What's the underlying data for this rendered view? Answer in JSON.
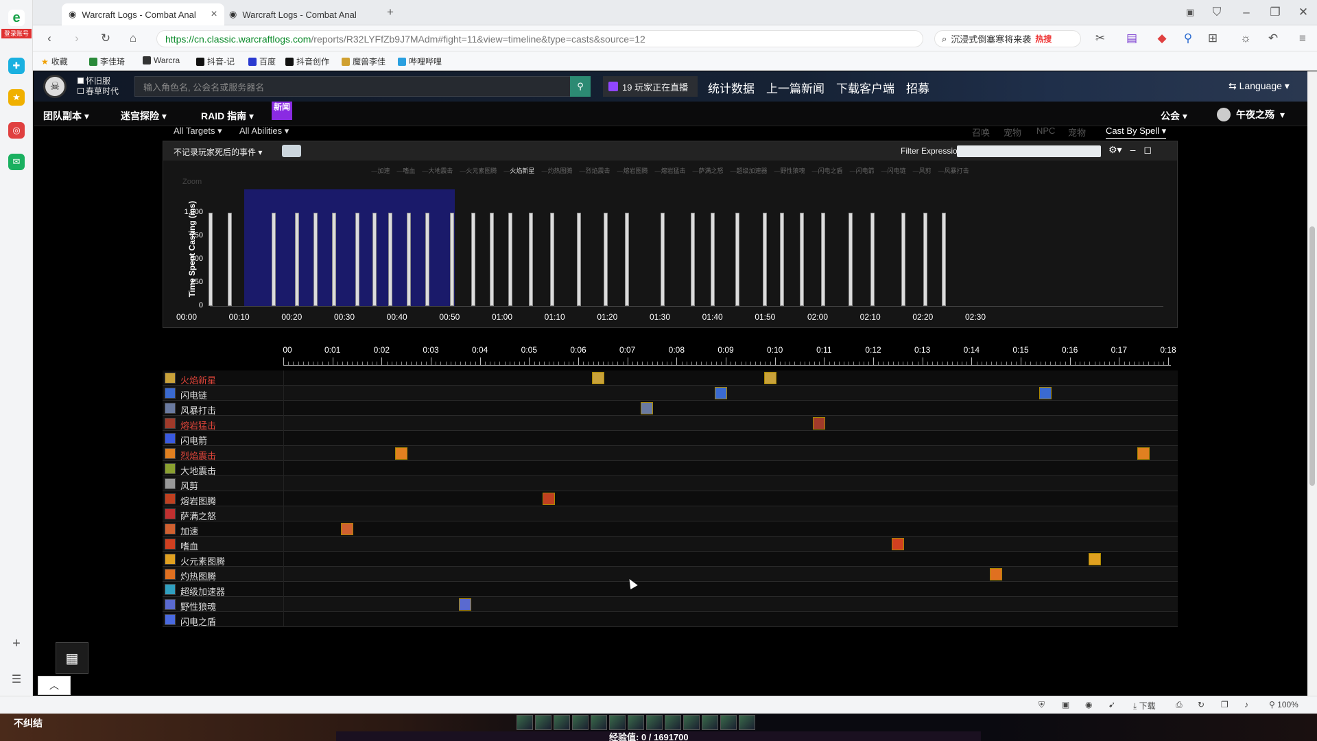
{
  "browser": {
    "tabs": [
      {
        "title": "Warcraft Logs - Combat Anal"
      },
      {
        "title": "Warcraft Logs - Combat Anal"
      }
    ],
    "url_main": "https://cn.classic.warcraftlogs.com",
    "url_rest": "/reports/R32LYFfZb9J7MAdm#fight=11&view=timeline&type=casts&source=12",
    "search_text": "沉浸式倒塞寒将来袭",
    "search_hot": "热搜",
    "bookmarks": [
      "收藏",
      "李佳琦",
      "Warcra",
      "抖音-记",
      "百度",
      "抖音创作",
      "魔兽李佳",
      "哔哩哔哩"
    ],
    "left_badge": "登录账号",
    "zoom": "100%",
    "download": "下载"
  },
  "site": {
    "checkboxes": [
      "怀旧服",
      "春草时代"
    ],
    "search_placeholder": "输入角色名, 公会名或服务器名",
    "twitch": "19 玩家正在直播",
    "nav": [
      "统计数据",
      "上一篇新闻",
      "下载客户端",
      "招募"
    ],
    "language": "Language",
    "menu": [
      "团队副本",
      "迷宫探险",
      "RAID 指南"
    ],
    "new_badge": "新闻",
    "guild": "公会",
    "user": "午夜之殇"
  },
  "filters": {
    "targets": "All Targets",
    "abilities": "All Abilities",
    "dim": [
      "召唤",
      "宠物",
      "NPC",
      "宠物"
    ],
    "cast_by": "Cast By Spell"
  },
  "chart_panel": {
    "death_filter": "不记录玩家死后的事件",
    "filter_label": "Filter Expression:",
    "zoom_label": "Zoom"
  },
  "chart_data": {
    "type": "bar",
    "ylabel": "Time Spent Casting (ms)",
    "y_ticks": [
      "0",
      "250",
      "500",
      "750",
      "1,000"
    ],
    "ylim": [
      0,
      1250
    ],
    "x_ticks": [
      "00:00",
      "00:10",
      "00:20",
      "00:30",
      "00:40",
      "00:50",
      "01:00",
      "01:10",
      "01:20",
      "01:30",
      "01:40",
      "01:50",
      "02:00",
      "02:10",
      "02:20",
      "02:30"
    ],
    "xlim_seconds": [
      0,
      150
    ],
    "selection_seconds": [
      11,
      51
    ],
    "legend": [
      "加速",
      "嗜血",
      "大地震击",
      "火元素图腾",
      "火焰新星",
      "灼热图腾",
      "烈焰震击",
      "熔岩图腾",
      "熔岩猛击",
      "萨满之怒",
      "超级加速器",
      "野性狼魂",
      "闪电之盾",
      "闪电箭",
      "闪电链",
      "风剪",
      "风暴打击"
    ],
    "legend_active": "火焰新星",
    "series": [
      {
        "x_seconds": [
          4.5,
          8.2,
          16.5,
          21,
          24.5,
          28,
          32.5,
          35.7,
          38.8,
          42.2,
          45.8,
          50.5,
          54.5,
          58,
          61.5,
          65.5,
          69.5,
          74.6,
          79.7,
          83.8,
          90.5,
          96.2,
          100,
          104.7,
          110,
          113.2,
          117,
          121,
          126.3,
          130.4,
          136.3,
          140.5,
          144
        ],
        "values": [
          1000,
          1000,
          1000,
          1000,
          1000,
          1000,
          1000,
          1000,
          1000,
          1000,
          1000,
          1000,
          1000,
          1000,
          1000,
          1000,
          1000,
          1000,
          1000,
          1000,
          1000,
          1000,
          1000,
          1000,
          1000,
          1000,
          1000,
          1000,
          1000,
          1000,
          1000,
          1000,
          1000
        ]
      }
    ]
  },
  "timeline": {
    "ticks": [
      "00",
      "0:01",
      "0:02",
      "0:03",
      "0:04",
      "0:05",
      "0:06",
      "0:07",
      "0:08",
      "0:09",
      "0:10",
      "0:11",
      "0:12",
      "0:13",
      "0:14",
      "0:15",
      "0:16",
      "0:17",
      "0:18"
    ],
    "rows": [
      {
        "name": "火焰新星",
        "color": "#e0453a",
        "icon": "#c9a23a",
        "casts": [
          6.4,
          9.9
        ]
      },
      {
        "name": "闪电链",
        "color": "#dddddd",
        "icon": "#3a6ad0",
        "casts": [
          8.9,
          15.5
        ]
      },
      {
        "name": "风暴打击",
        "color": "#dddddd",
        "icon": "#6a7aa0",
        "casts": [
          7.4
        ]
      },
      {
        "name": "熔岩猛击",
        "color": "#e0453a",
        "icon": "#a03a2a",
        "casts": [
          10.9
        ]
      },
      {
        "name": "闪电箭",
        "color": "#dddddd",
        "icon": "#3a5ae0",
        "casts": []
      },
      {
        "name": "烈焰震击",
        "color": "#e0453a",
        "icon": "#e08020",
        "casts": [
          2.4,
          17.5
        ]
      },
      {
        "name": "大地震击",
        "color": "#dddddd",
        "icon": "#8aa030",
        "casts": []
      },
      {
        "name": "风剪",
        "color": "#dddddd",
        "icon": "#999999",
        "casts": []
      },
      {
        "name": "熔岩图腾",
        "color": "#dddddd",
        "icon": "#c04020",
        "casts": [
          5.4
        ]
      },
      {
        "name": "萨满之怒",
        "color": "#dddddd",
        "icon": "#c03030",
        "casts": []
      },
      {
        "name": "加速",
        "color": "#dddddd",
        "icon": "#d06030",
        "casts": [
          1.3
        ]
      },
      {
        "name": "嗜血",
        "color": "#dddddd",
        "icon": "#d04020",
        "casts": [
          12.5
        ]
      },
      {
        "name": "火元素图腾",
        "color": "#dddddd",
        "icon": "#e0a020",
        "casts": [
          16.5
        ]
      },
      {
        "name": "灼热图腾",
        "color": "#dddddd",
        "icon": "#e07020",
        "casts": [
          14.5
        ]
      },
      {
        "name": "超级加速器",
        "color": "#dddddd",
        "icon": "#30a0c0",
        "casts": []
      },
      {
        "name": "野性狼魂",
        "color": "#dddddd",
        "icon": "#5a6ad0",
        "casts": [
          3.7
        ]
      },
      {
        "name": "闪电之盾",
        "color": "#dddddd",
        "icon": "#4a6ae0",
        "casts": []
      }
    ]
  },
  "game": {
    "name_tag": "不纠结",
    "xp_text": "经验值: 0 / 1691700"
  }
}
